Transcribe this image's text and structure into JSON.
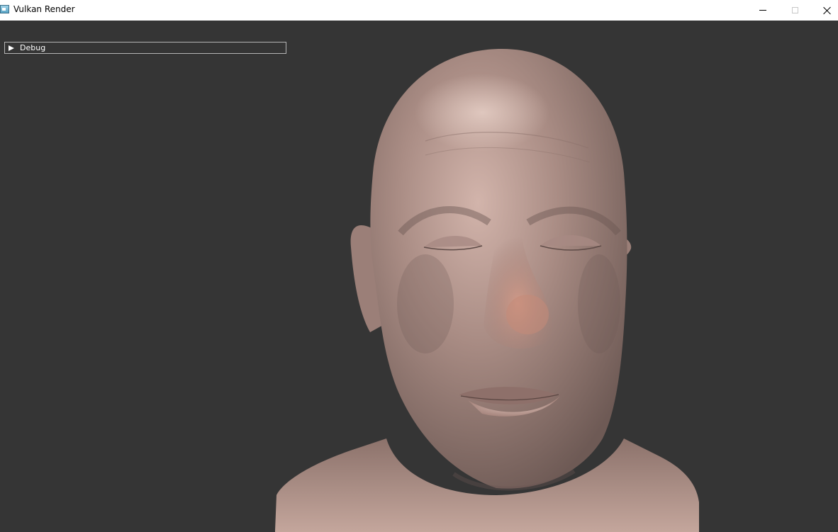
{
  "window": {
    "title": "Vulkan Render",
    "icon": "app-window-icon",
    "controls": [
      "minimize-icon",
      "maximize-icon",
      "close-icon"
    ]
  },
  "debug_panel": {
    "label": "Debug",
    "arrow_icon": "collapsed-triangle-icon"
  },
  "colors": {
    "viewport_background": "#353535",
    "skin": "#b08f84",
    "title_bar": "#ffffff"
  }
}
